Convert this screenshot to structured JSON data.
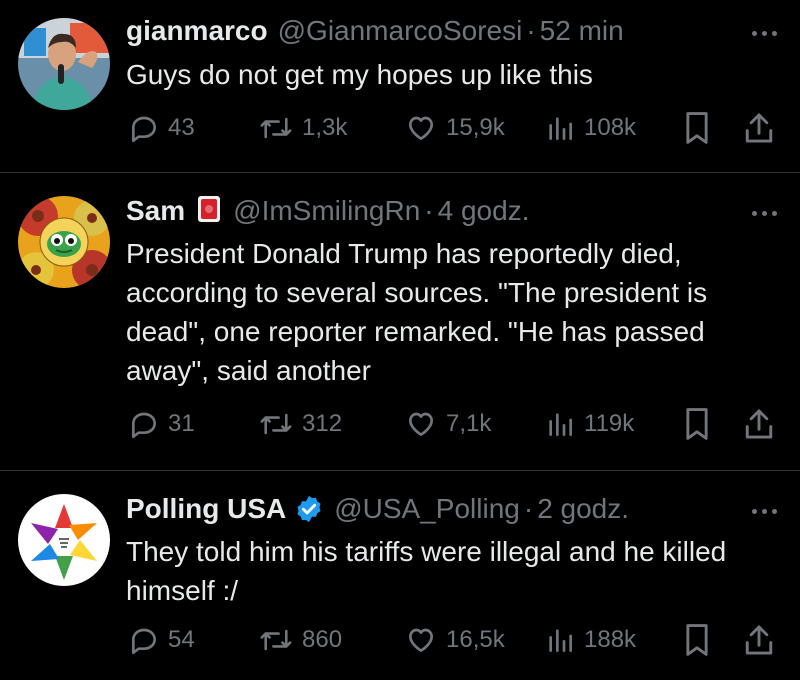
{
  "tweets": [
    {
      "name": "gianmarco",
      "handle": "@GianmarcoSoresi",
      "separator": "·",
      "time": "52 min",
      "text": "Guys do not get my hopes up like this",
      "replies": "43",
      "reposts": "1,3k",
      "likes": "15,9k",
      "views": "108k",
      "avatar_icon": "person-photo-avatar"
    },
    {
      "name": "Sam",
      "handle": "@ImSmilingRn",
      "separator": "·",
      "time": "4 godz.",
      "text": "President Donald Trump has reportedly died, according to several sources. \"The president is dead\", one reporter remarked. \"He has passed away\", said another",
      "replies": "31",
      "reposts": "312",
      "likes": "7,1k",
      "views": "119k",
      "avatar_icon": "gears-frog-avatar",
      "name_emoji": "red-card-emoji"
    },
    {
      "name": "Polling USA",
      "handle": "@USA_Polling",
      "separator": "·",
      "time": "2 godz.",
      "text": "They told him his tariffs were illegal and he killed himself :/",
      "replies": "54",
      "reposts": "860",
      "likes": "16,5k",
      "views": "188k",
      "avatar_icon": "star-logo-avatar",
      "verified_icon": "verified-badge-icon"
    }
  ],
  "colors": {
    "background": "#000000",
    "text": "#e7e9ea",
    "muted": "#71767b",
    "divider": "#2f3336",
    "verified": "#1d9bf0"
  }
}
